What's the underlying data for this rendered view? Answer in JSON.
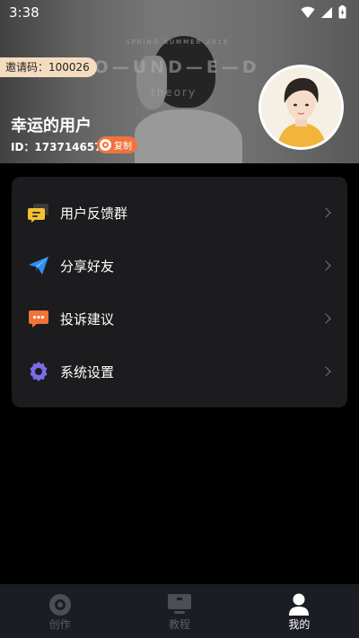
{
  "status_bar": {
    "time": "3:38"
  },
  "profile": {
    "invite_label": "邀请码：100026",
    "username": "幸运的用户",
    "user_id": "ID：17371465771",
    "copy_label": "复制"
  },
  "banner_text": {
    "small": "SPRING SUMMER 2015",
    "big": "RO—UND—E—D",
    "sub": "theory"
  },
  "menu": {
    "items": [
      {
        "label": "用户反馈群",
        "icon": "chat-bubbles-icon"
      },
      {
        "label": "分享好友",
        "icon": "paper-plane-icon"
      },
      {
        "label": "投诉建议",
        "icon": "message-dots-icon"
      },
      {
        "label": "系统设置",
        "icon": "gear-icon"
      }
    ]
  },
  "nav": {
    "items": [
      {
        "label": "创作",
        "icon": "create-disc-icon",
        "active": false
      },
      {
        "label": "教程",
        "icon": "tutorial-icon",
        "active": false
      },
      {
        "label": "我的",
        "icon": "profile-icon",
        "active": true
      }
    ]
  },
  "colors": {
    "accent_orange": "#f1733b",
    "invite_bg": "#f3dcc0",
    "card_bg": "#1c1c1e",
    "nav_bg": "#1b1d24"
  }
}
